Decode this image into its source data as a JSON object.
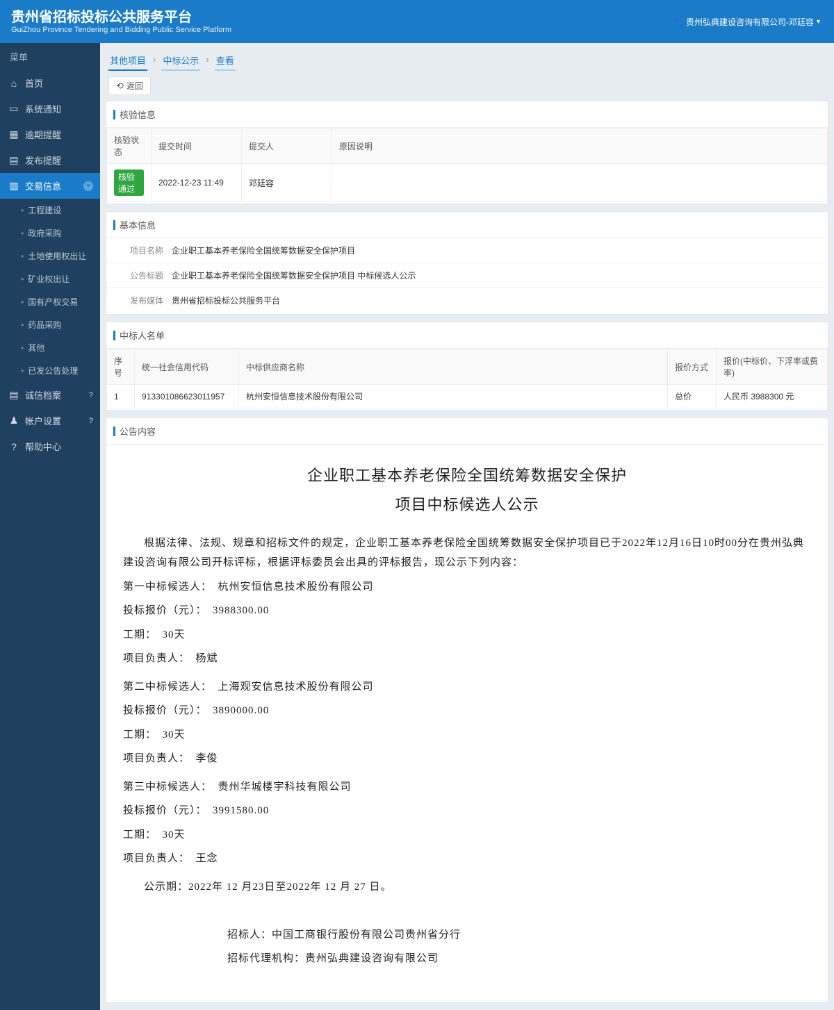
{
  "header": {
    "title_cn": "贵州省招标投标公共服务平台",
    "title_en": "GuiZhou Province Tendering and Bidding Public Service Platform",
    "user_text": "贵州弘典建设咨询有限公司-邓廷容"
  },
  "sidebar": {
    "group_label": "菜单",
    "items": {
      "home": "首页",
      "notice": "系统通知",
      "overdue": "逾期提醒",
      "publish": "发布提醒",
      "trade": "交易信息",
      "integrity": "诚信档案",
      "account": "帐户设置",
      "help": "帮助中心"
    },
    "trade_sub": [
      "工程建设",
      "政府采购",
      "土地使用权出让",
      "矿业权出让",
      "国有产权交易",
      "药品采购",
      "其他",
      "已发公告处理"
    ]
  },
  "crumbs": [
    "其他项目",
    "中标公示",
    "查看"
  ],
  "back_label": "返回",
  "verify_panel": {
    "title": "核验信息",
    "headers": [
      "核验状态",
      "提交时间",
      "提交人",
      "原因说明"
    ],
    "row": {
      "status": "核验通过",
      "time": "2022-12-23 11:49",
      "submitter": "邓廷容",
      "reason": ""
    }
  },
  "basic_panel": {
    "title": "基本信息",
    "rows": [
      {
        "label": "项目名称",
        "value": "企业职工基本养老保险全国统筹数据安全保护项目"
      },
      {
        "label": "公告标题",
        "value": "企业职工基本养老保险全国统筹数据安全保护项目 中标候选人公示"
      },
      {
        "label": "发布媒体",
        "value": "贵州省招标投标公共服务平台"
      }
    ]
  },
  "winner_panel": {
    "title": "中标人名单",
    "headers": [
      "序号",
      "统一社会信用代码",
      "中标供应商名称",
      "报价方式",
      "报价(中标价、下浮率或费率)"
    ],
    "rows": [
      {
        "no": "1",
        "code": "913301086623011957",
        "name": "杭州安恒信息技术股份有限公司",
        "method": "总价",
        "price": "人民币 3988300 元"
      }
    ]
  },
  "content_panel": {
    "title": "公告内容",
    "h1": "企业职工基本养老保险全国统筹数据安全保护",
    "h2": "项目中标候选人公示",
    "intro": "根据法律、法规、规章和招标文件的规定，企业职工基本养老保险全国统筹数据安全保护项目已于2022年12月16日10时00分在贵州弘典建设咨询有限公司开标评标，根据评标委员会出具的评标报告，现公示下列内容：",
    "candidates": [
      {
        "rank": "第一中标候选人：　杭州安恒信息技术股份有限公司",
        "price": "投标报价（元）：　3988300.00",
        "duration": "工期：　30天",
        "pm": "项目负责人：　杨斌"
      },
      {
        "rank": "第二中标候选人：　上海观安信息技术股份有限公司",
        "price": "投标报价（元）：　3890000.00",
        "duration": "工期：　30天",
        "pm": "项目负责人：　李俊"
      },
      {
        "rank": "第三中标候选人：　贵州华城楼宇科技有限公司",
        "price": "投标报价（元）：　3991580.00",
        "duration": "工期：　30天",
        "pm": "项目负责人：　王念"
      }
    ],
    "period": "公示期：2022年 12 月23日至2022年 12 月 27 日。",
    "sig_buyer": "招标人：中国工商银行股份有限公司贵州省分行",
    "sig_agent": "招标代理机构：贵州弘典建设咨询有限公司"
  }
}
